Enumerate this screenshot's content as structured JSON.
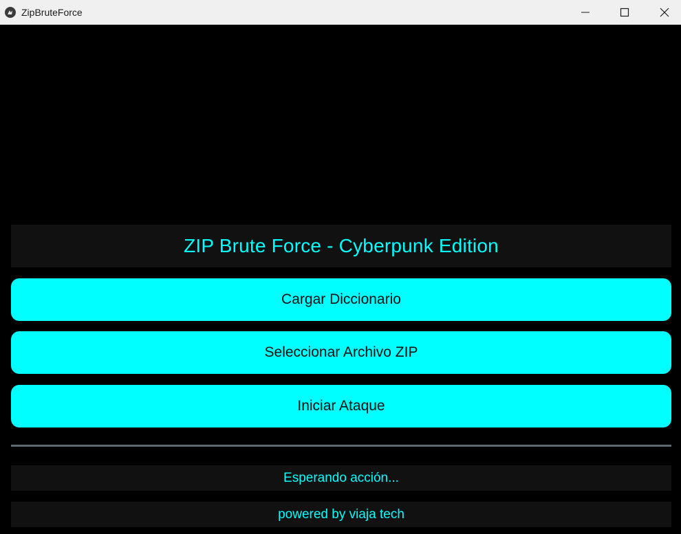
{
  "window": {
    "title": "ZipBruteForce",
    "app_icon": "kivy-logo-icon",
    "controls": {
      "minimize": "minimize-icon",
      "maximize": "maximize-icon",
      "close": "close-icon"
    }
  },
  "header": {
    "title": "ZIP Brute Force - Cyberpunk Edition"
  },
  "buttons": {
    "load_dictionary": "Cargar Diccionario",
    "select_zip": "Seleccionar Archivo ZIP",
    "start_attack": "Iniciar Ataque"
  },
  "progress": {
    "value": 0
  },
  "status": {
    "text": "Esperando acción..."
  },
  "footer": {
    "text": "powered by viaja tech"
  },
  "colors": {
    "accent": "#00ffff",
    "background": "#000000",
    "panel": "#111111",
    "progress_track": "#5f6b72"
  }
}
